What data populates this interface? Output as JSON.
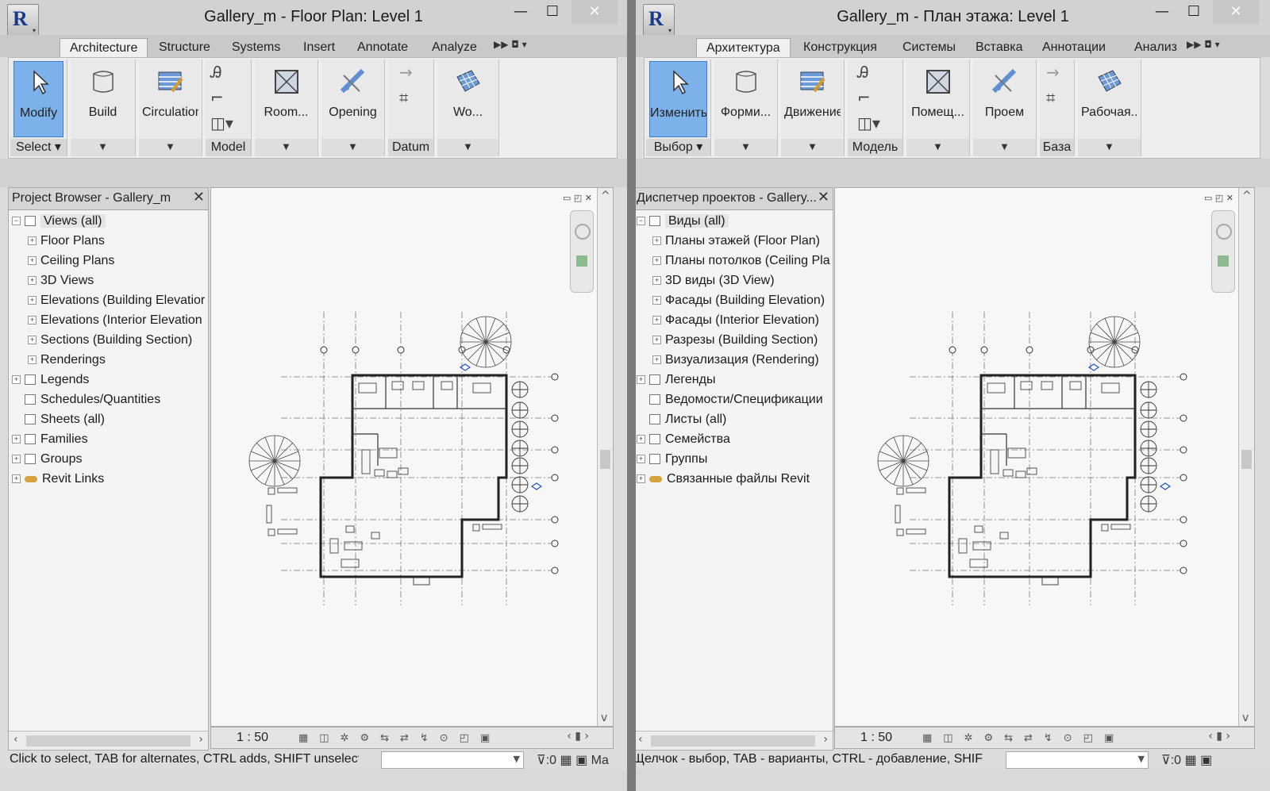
{
  "left": {
    "title": "Gallery_m - Floor Plan: Level 1",
    "tabs": [
      "Architecture",
      "Structure",
      "Systems",
      "Insert",
      "Annotate",
      "Analyze"
    ],
    "ribbon": {
      "modify": "Modify",
      "build": "Build",
      "circulation": "Circulation",
      "room": "Room...",
      "opening": "Opening",
      "workplane": "Wo...",
      "panel_select": "Select",
      "panel_model": "Model",
      "panel_datum": "Datum"
    },
    "browser": {
      "title": "Project Browser - Gallery_m",
      "items": [
        "Views (all)",
        "Floor Plans",
        "Ceiling Plans",
        "3D Views",
        "Elevations (Building Elevatior",
        "Elevations (Interior Elevation",
        "Sections (Building Section)",
        "Renderings",
        "Legends",
        "Schedules/Quantities",
        "Sheets (all)",
        "Families",
        "Groups",
        "Revit Links"
      ]
    },
    "scale": "1 : 50",
    "status": "Click to select, TAB for alternates, CTRL adds, SHIFT unselects.",
    "filter_count": ":0",
    "trailing": "Ma"
  },
  "right": {
    "title": "Gallery_m - План этажа: Level 1",
    "tabs": [
      "Архитектура",
      "Конструкция",
      "Системы",
      "Вставка",
      "Аннотации",
      "Анализ"
    ],
    "ribbon": {
      "modify": "Изменить",
      "build": "Форми...",
      "circulation": "Движение",
      "room": "Помещ...",
      "opening": "Проем",
      "workplane": "Рабочая...",
      "panel_select": "Выбор",
      "panel_model": "Модель",
      "panel_datum": "База"
    },
    "browser": {
      "title": "Диспетчер проектов - Gallery...",
      "items": [
        "Виды (all)",
        "Планы этажей (Floor Plan)",
        "Планы потолков (Ceiling Pla",
        "3D виды (3D View)",
        "Фасады (Building Elevation)",
        "Фасады (Interior Elevation)",
        "Разрезы (Building Section)",
        "Визуализация (Rendering)",
        "Легенды",
        "Ведомости/Спецификации",
        "Листы (all)",
        "Семейства",
        "Группы",
        "Связанные файлы Revit"
      ]
    },
    "scale": "1 : 50",
    "status": "Щелчок - выбор, TAB - варианты, CTRL - добавление, SHIF",
    "filter_count": ":0"
  },
  "icons": {
    "app": "R",
    "minimize": "—",
    "maximize": "☐",
    "close": "✕"
  },
  "colors": {
    "selected_button": "#7cb1ea",
    "revit_links": "#d6a23a"
  }
}
